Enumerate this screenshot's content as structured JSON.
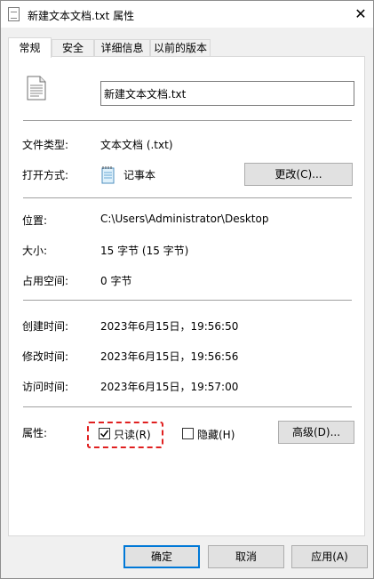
{
  "window": {
    "title": "新建文本文档.txt 属性",
    "close_glyph": "✕"
  },
  "tabs": [
    {
      "label": "常规",
      "active": true
    },
    {
      "label": "安全",
      "active": false
    },
    {
      "label": "详细信息",
      "active": false
    },
    {
      "label": "以前的版本",
      "active": false
    }
  ],
  "general": {
    "file_name": "新建文本文档.txt",
    "type_label": "文件类型:",
    "type_value": "文本文档 (.txt)",
    "opens_with_label": "打开方式:",
    "opens_with_value": "记事本",
    "change_button": "更改(C)...",
    "location_label": "位置:",
    "location_value": "C:\\Users\\Administrator\\Desktop",
    "size_label": "大小:",
    "size_value": "15 字节 (15 字节)",
    "size_on_disk_label": "占用空间:",
    "size_on_disk_value": "0 字节",
    "created_label": "创建时间:",
    "created_value": "2023年6月15日，19:56:50",
    "modified_label": "修改时间:",
    "modified_value": "2023年6月15日，19:56:56",
    "accessed_label": "访问时间:",
    "accessed_value": "2023年6月15日，19:57:00",
    "attributes_label": "属性:",
    "readonly_label": "只读(R)",
    "readonly_checked": true,
    "hidden_label": "隐藏(H)",
    "hidden_checked": false,
    "advanced_button": "高级(D)..."
  },
  "footer": {
    "ok": "确定",
    "cancel": "取消",
    "apply": "应用(A)"
  },
  "colors": {
    "accent": "#0078d7",
    "highlight": "#e02020"
  }
}
